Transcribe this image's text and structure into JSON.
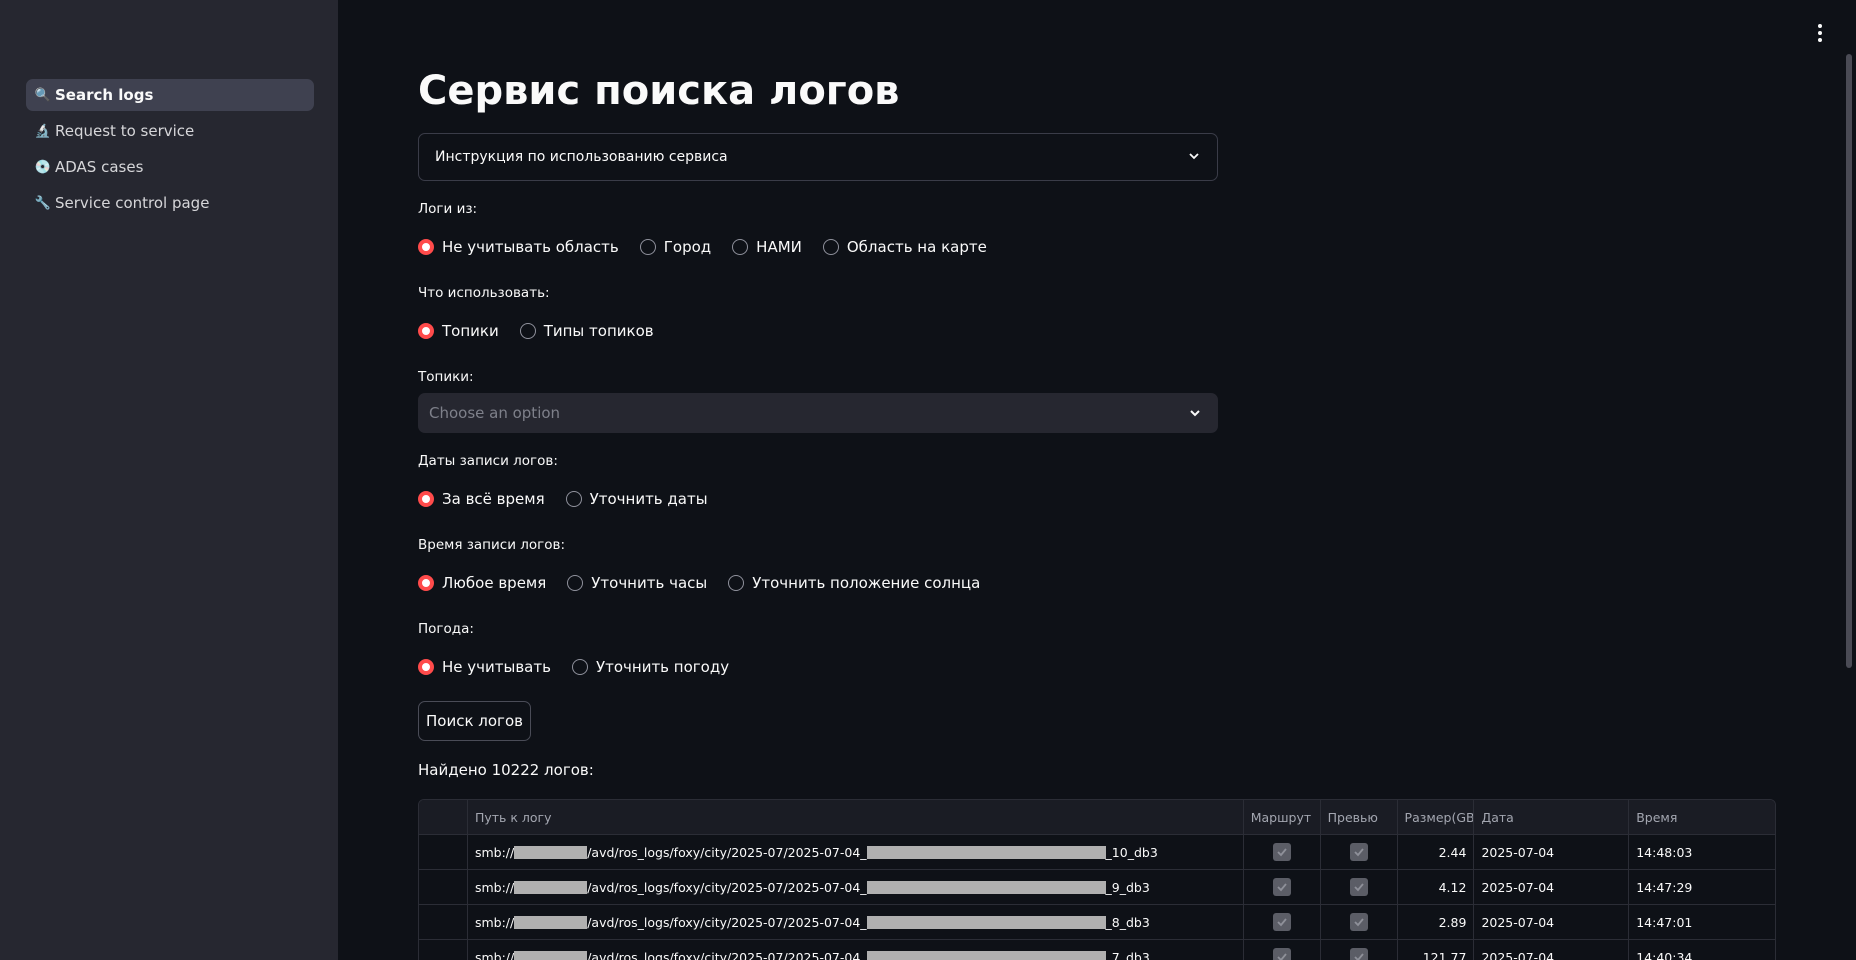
{
  "sidebar": {
    "items": [
      {
        "icon": "🔍",
        "label": "Search logs",
        "active": true
      },
      {
        "icon": "🔬",
        "label": "Request to service",
        "active": false
      },
      {
        "icon": "💿",
        "label": "ADAS cases",
        "active": false
      },
      {
        "icon": "🔧",
        "label": "Service control page",
        "active": false
      }
    ]
  },
  "main": {
    "title": "Сервис поиска логов",
    "expander_label": "Инструкция по использованию сервиса",
    "logs_from": {
      "label": "Логи из:",
      "options": [
        "Не учитывать область",
        "Город",
        "НАМИ",
        "Область на карте"
      ],
      "selected": 0
    },
    "what_use": {
      "label": "Что использовать:",
      "options": [
        "Топики",
        "Типы топиков"
      ],
      "selected": 0
    },
    "topics": {
      "label": "Топики:",
      "placeholder": "Choose an option"
    },
    "dates": {
      "label": "Даты записи логов:",
      "options": [
        "За всё время",
        "Уточнить даты"
      ],
      "selected": 0
    },
    "time": {
      "label": "Время записи логов:",
      "options": [
        "Любое время",
        "Уточнить часы",
        "Уточнить положение солнца"
      ],
      "selected": 0
    },
    "weather": {
      "label": "Погода:",
      "options": [
        "Не учитывать",
        "Уточнить погоду"
      ],
      "selected": 0
    },
    "search_button": "Поиск логов",
    "found_text": "Найдено 10222 логов:"
  },
  "table": {
    "columns": [
      "Путь к логу",
      "Маршрут",
      "Превью",
      "Размер(GB)",
      "Дата",
      "Время"
    ],
    "rows": [
      {
        "path_prefix": "smb://",
        "path_mid": "/avd/ros_logs/foxy/city/2025-07/2025-07-04_",
        "path_suffix": "_10_db3",
        "size": "2.44",
        "date": "2025-07-04",
        "time": "14:48:03"
      },
      {
        "path_prefix": "smb://",
        "path_mid": "/avd/ros_logs/foxy/city/2025-07/2025-07-04_",
        "path_suffix": "_9_db3",
        "size": "4.12",
        "date": "2025-07-04",
        "time": "14:47:29"
      },
      {
        "path_prefix": "smb://",
        "path_mid": "/avd/ros_logs/foxy/city/2025-07/2025-07-04_",
        "path_suffix": "_8_db3",
        "size": "2.89",
        "date": "2025-07-04",
        "time": "14:47:01"
      },
      {
        "path_prefix": "smb://",
        "path_mid": "/avd/ros_logs/foxy/city/2025-07/2025-07-04_",
        "path_suffix": "_7_db3",
        "size": "121.77",
        "date": "2025-07-04",
        "time": "14:40:34"
      }
    ]
  },
  "colors": {
    "accent": "#ff4b4b",
    "background": "#0e1117",
    "sidebar": "#262730"
  }
}
